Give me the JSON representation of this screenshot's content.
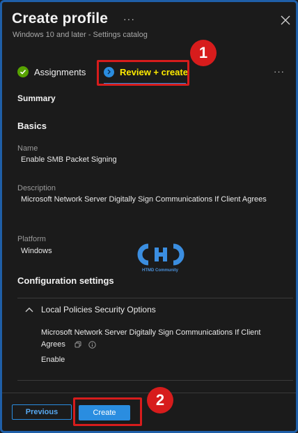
{
  "header": {
    "title": "Create profile",
    "more": "···",
    "subtitle": "Windows 10 and later - Settings catalog"
  },
  "tabs": {
    "assignments_label": "Assignments",
    "review_label": "Review + create",
    "more": "···"
  },
  "callouts": {
    "one": "1",
    "two": "2"
  },
  "summary": {
    "heading": "Summary",
    "basics_heading": "Basics",
    "name_label": "Name",
    "name_value": "Enable SMB Packet Signing",
    "description_label": "Description",
    "description_value": "Microsoft Network Server Digitally Sign Communications If Client Agrees",
    "platform_label": "Platform",
    "platform_value": "Windows"
  },
  "watermark": {
    "text": "HTMD Community"
  },
  "configuration": {
    "heading": "Configuration settings",
    "group_title": "Local Policies Security Options",
    "setting_name_line1": "Microsoft Network Server Digitally Sign Communications If Client",
    "setting_name_line2": "Agrees",
    "setting_value": "Enable"
  },
  "footer": {
    "previous_label": "Previous",
    "create_label": "Create"
  },
  "colors": {
    "accent": "#2a8de0",
    "highlight": "#ffeb00",
    "callout_red": "#d71c1c",
    "success_green": "#57a300",
    "background": "#1b1b1b"
  },
  "icons": [
    "close-icon",
    "check-icon",
    "step-icon",
    "chevron-up-icon",
    "copy-icon",
    "info-icon"
  ]
}
